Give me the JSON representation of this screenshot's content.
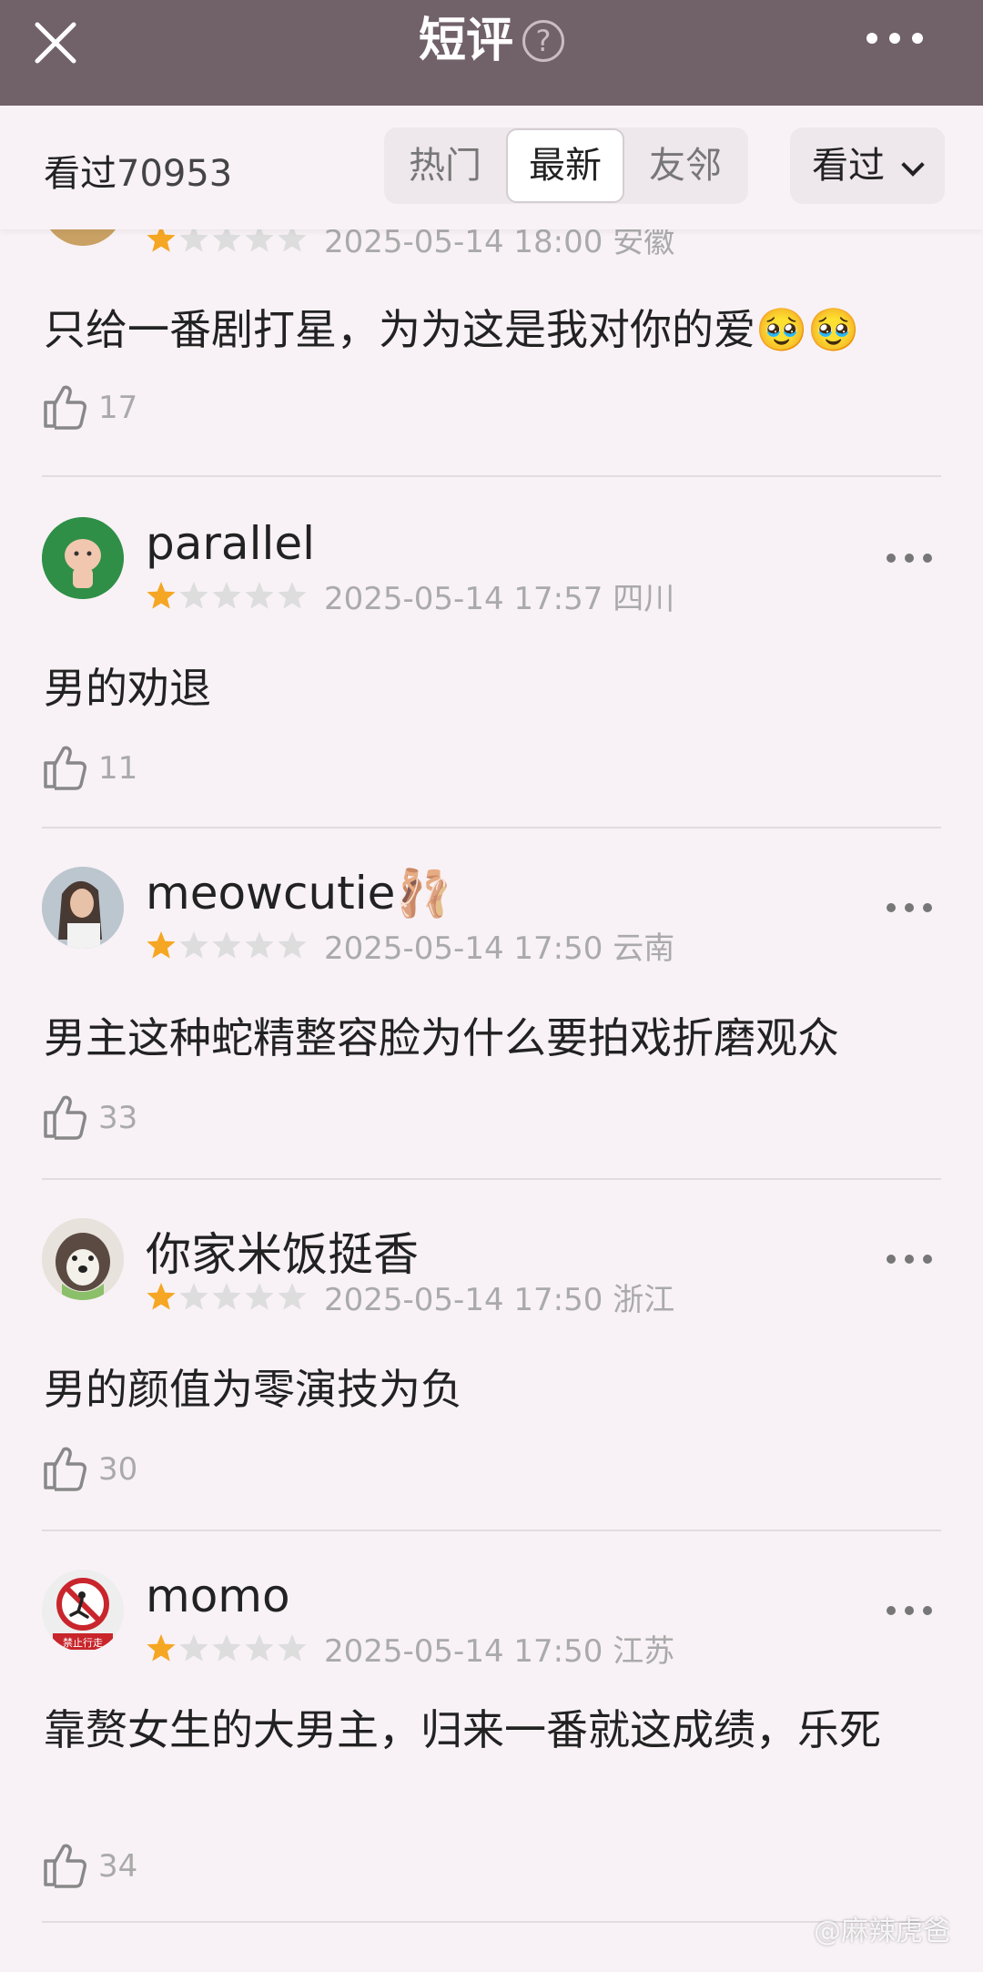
{
  "header": {
    "title": "短评",
    "help_glyph": "?",
    "close_icon": "close-icon",
    "more_icon": "more-icon"
  },
  "filter": {
    "count_label": "看过",
    "count_value": "70953",
    "tabs": [
      "热门",
      "最新",
      "友邻"
    ],
    "active_tab": "最新",
    "dropdown_label": "看过"
  },
  "reviews": [
    {
      "user": "",
      "rating": 1,
      "time": "2025-05-14 18:00",
      "location": "安徽",
      "text": "只给一番剧打星，为为这是我对你的爱🥹🥹",
      "likes": "17"
    },
    {
      "user": "parallel",
      "rating": 1,
      "time": "2025-05-14 17:57",
      "location": "四川",
      "text": "男的劝退",
      "likes": "11"
    },
    {
      "user": "meowcutie🩰",
      "rating": 1,
      "time": "2025-05-14 17:50",
      "location": "云南",
      "text": "男主这种蛇精整容脸为什么要拍戏折磨观众",
      "likes": "33"
    },
    {
      "user": "你家米饭挺香",
      "rating": 1,
      "time": "2025-05-14 17:50",
      "location": "浙江",
      "text": "男的颜值为零演技为负",
      "likes": "30"
    },
    {
      "user": "momo",
      "rating": 1,
      "time": "2025-05-14 17:50",
      "location": "江苏",
      "text": "靠赘女生的大男主，归来一番就这成绩，乐死",
      "likes": "34",
      "avatar_text": "禁止行走"
    }
  ],
  "colors": {
    "header_bg": "#716169",
    "page_bg": "#f8f2f6",
    "star_on": "#f5a623",
    "star_off": "#dddddd"
  },
  "watermark": "@麻辣虎爸"
}
